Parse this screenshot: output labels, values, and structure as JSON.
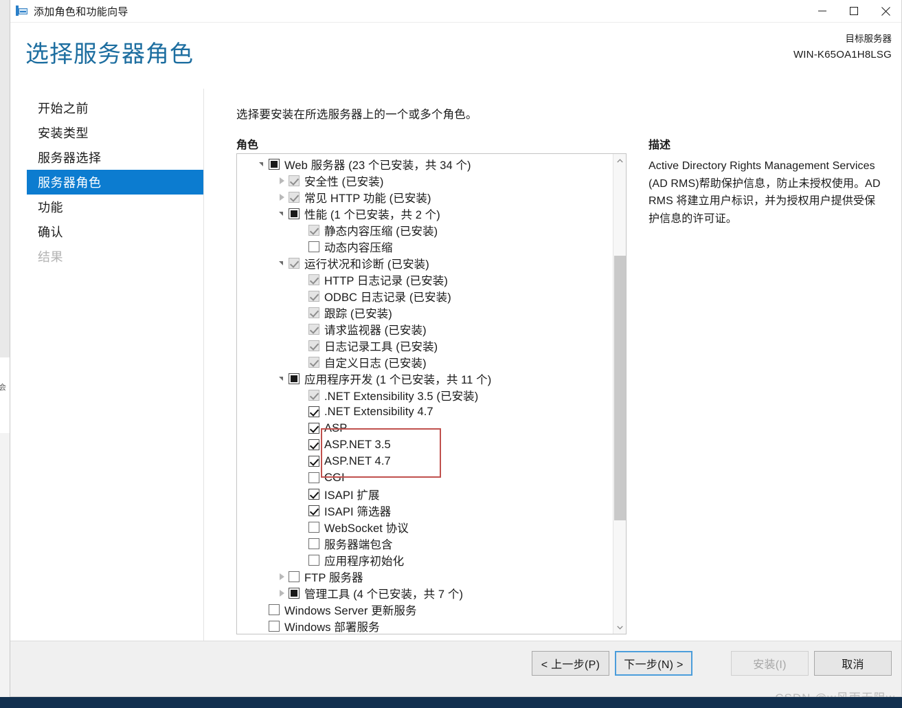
{
  "window": {
    "title": "添加角色和功能向导",
    "icon": "wizard-server-icon",
    "controls": {
      "minimize": "minimize-icon",
      "maximize": "maximize-icon",
      "close": "close-icon"
    }
  },
  "header": {
    "page_title": "选择服务器角色",
    "target_server_label": "目标服务器",
    "target_server_name": "WIN-K65OA1H8LSG"
  },
  "sidebar": {
    "items": [
      {
        "label": "开始之前",
        "state": "normal"
      },
      {
        "label": "安装类型",
        "state": "normal"
      },
      {
        "label": "服务器选择",
        "state": "normal"
      },
      {
        "label": "服务器角色",
        "state": "selected"
      },
      {
        "label": "功能",
        "state": "normal"
      },
      {
        "label": "确认",
        "state": "normal"
      },
      {
        "label": "结果",
        "state": "disabled"
      }
    ],
    "selected_color": "#0c7cd0"
  },
  "main": {
    "instruction": "选择要安装在所选服务器上的一个或多个角色。",
    "roles_label": "角色",
    "description_label": "描述",
    "description_text": "Active Directory Rights Management Services (AD RMS)帮助保护信息，防止未授权使用。AD RMS 将建立用户标识，并为授权用户提供受保护信息的许可证。",
    "annotation_color": "#c0504d"
  },
  "tree": {
    "rows": [
      {
        "indent": 0,
        "twisty": "expanded",
        "check": "partial",
        "label": "Web 服务器 (23 个已安装，共 34 个)"
      },
      {
        "indent": 1,
        "twisty": "collapsed",
        "check": "installed",
        "label": "安全性 (已安装)"
      },
      {
        "indent": 1,
        "twisty": "collapsed",
        "check": "installed",
        "label": "常见 HTTP 功能 (已安装)"
      },
      {
        "indent": 1,
        "twisty": "expanded",
        "check": "partial",
        "label": "性能 (1 个已安装，共 2 个)"
      },
      {
        "indent": 2,
        "twisty": "none",
        "check": "installed",
        "label": "静态内容压缩 (已安装)"
      },
      {
        "indent": 2,
        "twisty": "none",
        "check": "empty",
        "label": "动态内容压缩"
      },
      {
        "indent": 1,
        "twisty": "expanded",
        "check": "installed",
        "label": "运行状况和诊断 (已安装)"
      },
      {
        "indent": 2,
        "twisty": "none",
        "check": "installed",
        "label": "HTTP 日志记录 (已安装)"
      },
      {
        "indent": 2,
        "twisty": "none",
        "check": "installed",
        "label": "ODBC 日志记录 (已安装)"
      },
      {
        "indent": 2,
        "twisty": "none",
        "check": "installed",
        "label": "跟踪 (已安装)"
      },
      {
        "indent": 2,
        "twisty": "none",
        "check": "installed",
        "label": "请求监视器 (已安装)"
      },
      {
        "indent": 2,
        "twisty": "none",
        "check": "installed",
        "label": "日志记录工具 (已安装)"
      },
      {
        "indent": 2,
        "twisty": "none",
        "check": "installed",
        "label": "自定义日志 (已安装)"
      },
      {
        "indent": 1,
        "twisty": "expanded",
        "check": "partial",
        "label": "应用程序开发 (1 个已安装，共 11 个)"
      },
      {
        "indent": 2,
        "twisty": "none",
        "check": "installed",
        "label": ".NET Extensibility 3.5 (已安装)"
      },
      {
        "indent": 2,
        "twisty": "none",
        "check": "checked",
        "label": ".NET Extensibility 4.7"
      },
      {
        "indent": 2,
        "twisty": "none",
        "check": "checked",
        "label": "ASP"
      },
      {
        "indent": 2,
        "twisty": "none",
        "check": "checked",
        "label": "ASP.NET 3.5"
      },
      {
        "indent": 2,
        "twisty": "none",
        "check": "checked",
        "label": "ASP.NET 4.7"
      },
      {
        "indent": 2,
        "twisty": "none",
        "check": "empty",
        "label": "CGI"
      },
      {
        "indent": 2,
        "twisty": "none",
        "check": "checked",
        "label": "ISAPI 扩展"
      },
      {
        "indent": 2,
        "twisty": "none",
        "check": "checked",
        "label": "ISAPI 筛选器"
      },
      {
        "indent": 2,
        "twisty": "none",
        "check": "empty",
        "label": "WebSocket 协议"
      },
      {
        "indent": 2,
        "twisty": "none",
        "check": "empty",
        "label": "服务器端包含"
      },
      {
        "indent": 2,
        "twisty": "none",
        "check": "empty",
        "label": "应用程序初始化"
      },
      {
        "indent": 1,
        "twisty": "collapsed",
        "check": "empty",
        "label": "FTP 服务器"
      },
      {
        "indent": 1,
        "twisty": "collapsed",
        "check": "partial",
        "label": "管理工具 (4 个已安装，共 7 个)"
      },
      {
        "indent": 0,
        "twisty": "none",
        "check": "empty",
        "label": "Windows Server 更新服务"
      },
      {
        "indent": 0,
        "twisty": "none",
        "check": "empty",
        "label": "Windows 部署服务"
      }
    ],
    "scrollbar": {
      "up_arrow": "chevron-up-icon",
      "down_arrow": "chevron-down-icon"
    }
  },
  "footer": {
    "buttons": [
      {
        "label": "< 上一步(P)",
        "state": "normal",
        "name": "previous-button"
      },
      {
        "label": "下一步(N) >",
        "state": "focused",
        "name": "next-button"
      },
      {
        "label": "安装(I)",
        "state": "disabled",
        "name": "install-button"
      },
      {
        "label": "取消",
        "state": "normal",
        "name": "cancel-button"
      }
    ]
  },
  "watermark": "CSDN @w风雨无阻w",
  "background_fragment": "会"
}
